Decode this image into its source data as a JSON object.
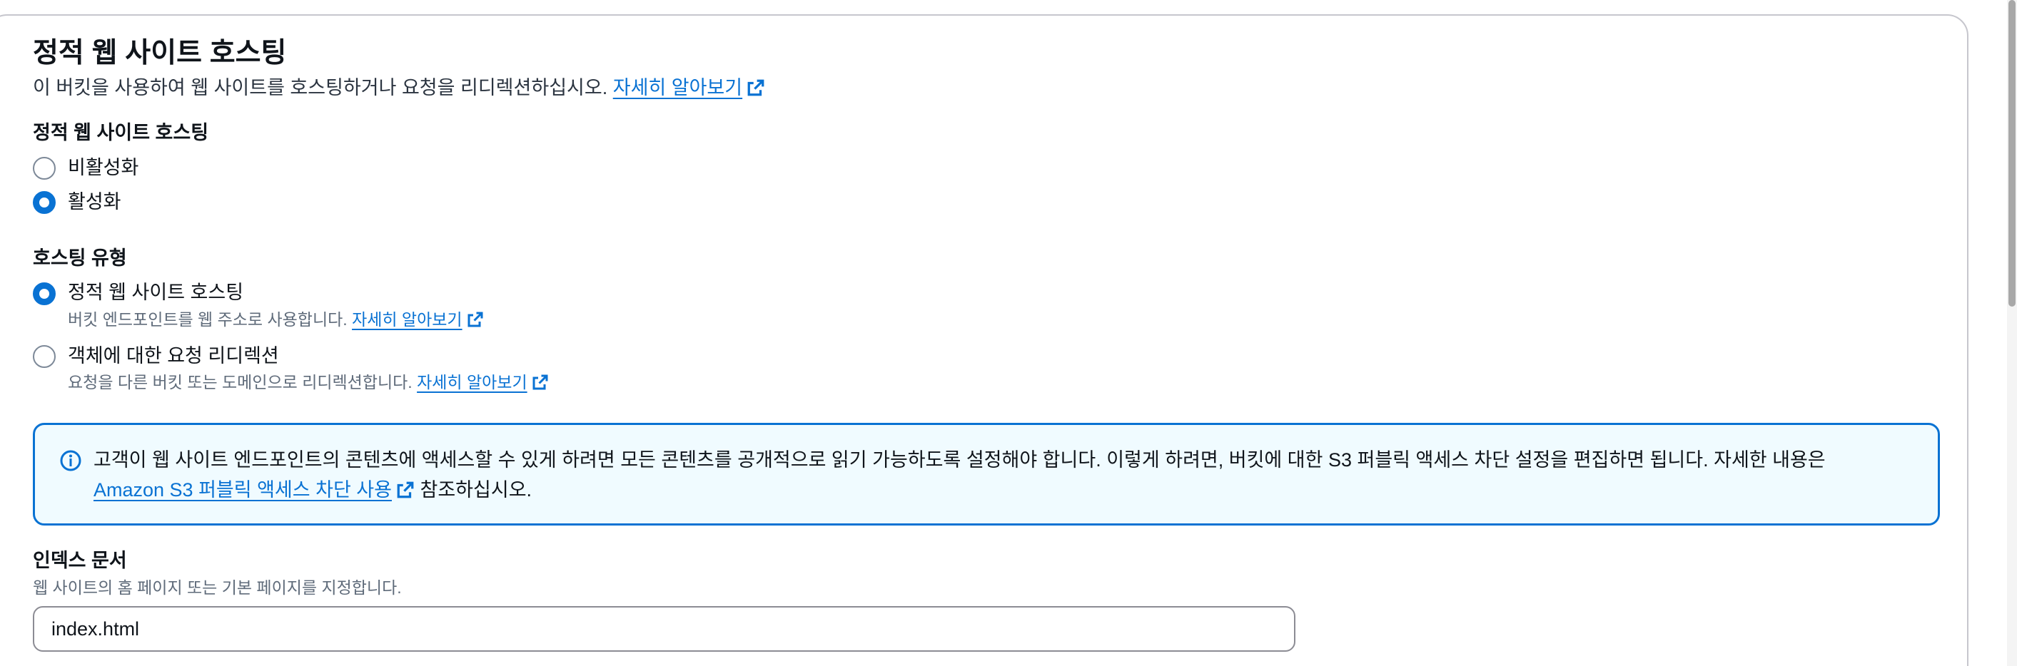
{
  "header": {
    "title": "정적 웹 사이트 호스팅",
    "description": "이 버킷을 사용하여 웹 사이트를 호스팅하거나 요청을 리디렉션하십시오.",
    "learn_more": "자세히 알아보기"
  },
  "static_hosting": {
    "label": "정적 웹 사이트 호스팅",
    "options": [
      {
        "label": "비활성화",
        "selected": false
      },
      {
        "label": "활성화",
        "selected": true
      }
    ]
  },
  "hosting_type": {
    "label": "호스팅 유형",
    "options": [
      {
        "label": "정적 웹 사이트 호스팅",
        "description": "버킷 엔드포인트를 웹 주소로 사용합니다.",
        "link": "자세히 알아보기",
        "selected": true
      },
      {
        "label": "객체에 대한 요청 리디렉션",
        "description": "요청을 다른 버킷 또는 도메인으로 리디렉션합니다.",
        "link": "자세히 알아보기",
        "selected": false
      }
    ]
  },
  "alert": {
    "text": "고객이 웹 사이트 엔드포인트의 콘텐츠에 액세스할 수 있게 하려면 모든 콘텐츠를 공개적으로 읽기 가능하도록 설정해야 합니다. 이렇게 하려면, 버킷에 대한 S3 퍼블릭 액세스 차단 설정을 편집하면 됩니다. 자세한 내용은",
    "link": "Amazon S3 퍼블릭 액세스 차단 사용",
    "suffix": "참조하십시오."
  },
  "index_document": {
    "label": "인덱스 문서",
    "hint": "웹 사이트의 홈 페이지 또는 기본 페이지를 지정합니다.",
    "value": "index.html"
  },
  "colors": {
    "accent": "#0972d3",
    "alert_background": "#f0fbff",
    "text": "#0f141a",
    "muted": "#5f6b7a"
  },
  "icons": {
    "external_link": "external-link-icon",
    "info": "info-icon"
  }
}
